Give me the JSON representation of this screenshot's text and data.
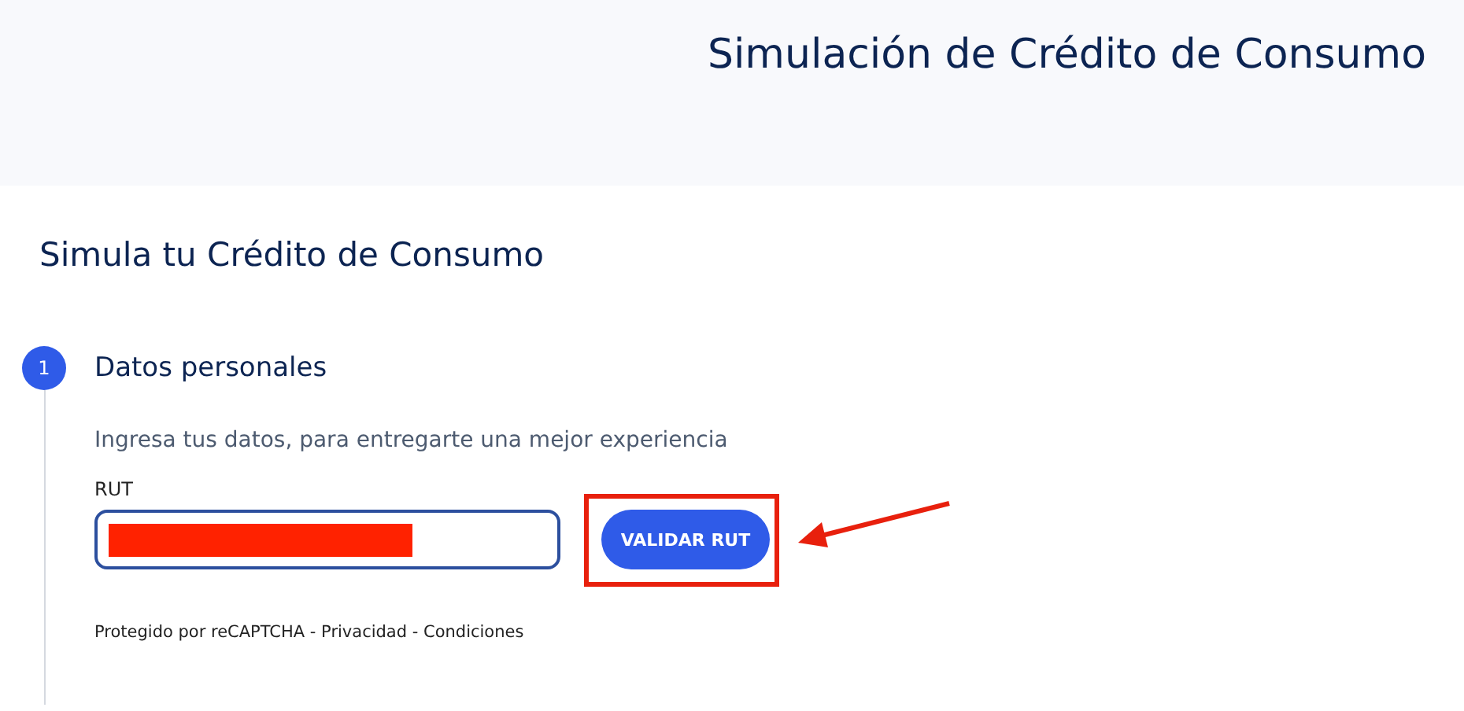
{
  "header": {
    "title": "Simulación de Crédito de Consumo"
  },
  "page_title": "Simula tu Crédito de Consumo",
  "step": {
    "number": "1",
    "title": "Datos personales",
    "description": "Ingresa tus datos, para entregarte una mejor experiencia"
  },
  "rut_field": {
    "label": "RUT"
  },
  "validate_button": {
    "label": "VALIDAR RUT"
  },
  "recaptcha_note": "Protegido por reCAPTCHA - Privacidad - Condiciones"
}
